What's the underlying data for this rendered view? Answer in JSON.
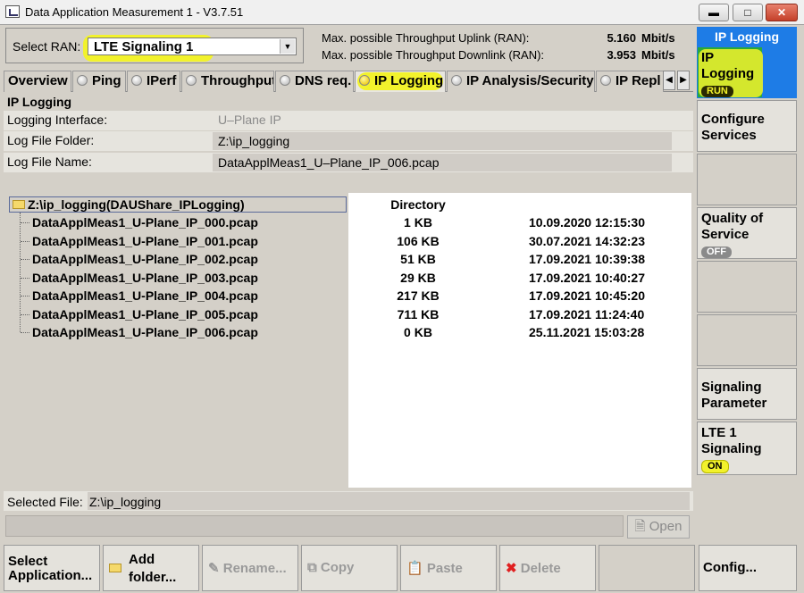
{
  "window": {
    "title": "Data Application Measurement 1 - V3.7.51"
  },
  "ran": {
    "label": "Select RAN:",
    "selected": "LTE Signaling 1",
    "uplink_label": "Max. possible Throughput Uplink (RAN):",
    "uplink_value": "5.160",
    "uplink_unit": "Mbit/s",
    "downlink_label": "Max. possible Throughput Downlink (RAN):",
    "downlink_value": "3.953",
    "downlink_unit": "Mbit/s"
  },
  "tabs": [
    {
      "label": "Overview"
    },
    {
      "label": "Ping"
    },
    {
      "label": "IPerf"
    },
    {
      "label": "Throughput"
    },
    {
      "label": "DNS req."
    },
    {
      "label": "IP Logging"
    },
    {
      "label": "IP Analysis/Security"
    },
    {
      "label": "IP Repl"
    }
  ],
  "section": {
    "title": "IP Logging",
    "interface_label": "Logging Interface:",
    "interface_value": "U–Plane IP",
    "folder_label": "Log File Folder:",
    "folder_value": "Z:\\ip_logging",
    "name_label": "Log File Name:",
    "name_value": "DataApplMeas1_U–Plane_IP_006.pcap"
  },
  "browser": {
    "root": "Z:\\ip_logging(DAUShare_IPLogging)",
    "root_type": "Directory",
    "files": [
      {
        "name": "DataApplMeas1_U-Plane_IP_000.pcap",
        "size": "1 KB",
        "date": "10.09.2020 12:15:30"
      },
      {
        "name": "DataApplMeas1_U-Plane_IP_001.pcap",
        "size": "106 KB",
        "date": "30.07.2021 14:32:23"
      },
      {
        "name": "DataApplMeas1_U-Plane_IP_002.pcap",
        "size": "51 KB",
        "date": "17.09.2021 10:39:38"
      },
      {
        "name": "DataApplMeas1_U-Plane_IP_003.pcap",
        "size": "29 KB",
        "date": "17.09.2021 10:40:27"
      },
      {
        "name": "DataApplMeas1_U-Plane_IP_004.pcap",
        "size": "217 KB",
        "date": "17.09.2021 10:45:20"
      },
      {
        "name": "DataApplMeas1_U-Plane_IP_005.pcap",
        "size": "711 KB",
        "date": "17.09.2021 11:24:40"
      },
      {
        "name": "DataApplMeas1_U-Plane_IP_006.pcap",
        "size": "0 KB",
        "date": "25.11.2021 15:03:28"
      }
    ],
    "selected_label": "Selected File:",
    "selected_value": "Z:\\ip_logging",
    "open_label": "Open"
  },
  "bottom": {
    "select_app_line1": "Select",
    "select_app_line2": "Application...",
    "add_folder_line1": "Add",
    "add_folder_line2": "folder...",
    "rename": "Rename...",
    "copy": "Copy",
    "paste": "Paste",
    "delete": "Delete",
    "config": "Config..."
  },
  "sidebar": {
    "header": "IP Logging",
    "ip_logging_line1": "IP",
    "ip_logging_line2": "Logging",
    "ip_logging_state": "RUN",
    "configure_line1": "Configure",
    "configure_line2": "Services",
    "qos_line1": "Quality of",
    "qos_line2": "Service",
    "qos_state": "OFF",
    "signaling_line1": "Signaling",
    "signaling_line2": "Parameter",
    "lte_line1": "LTE 1",
    "lte_line2": "Signaling",
    "lte_state": "ON"
  },
  "colors": {
    "highlight": "#f2f22c",
    "sidebar_header": "#1e7ce6",
    "ip_logging_active": "#2aa83a",
    "delete_icon": "#e02020"
  }
}
